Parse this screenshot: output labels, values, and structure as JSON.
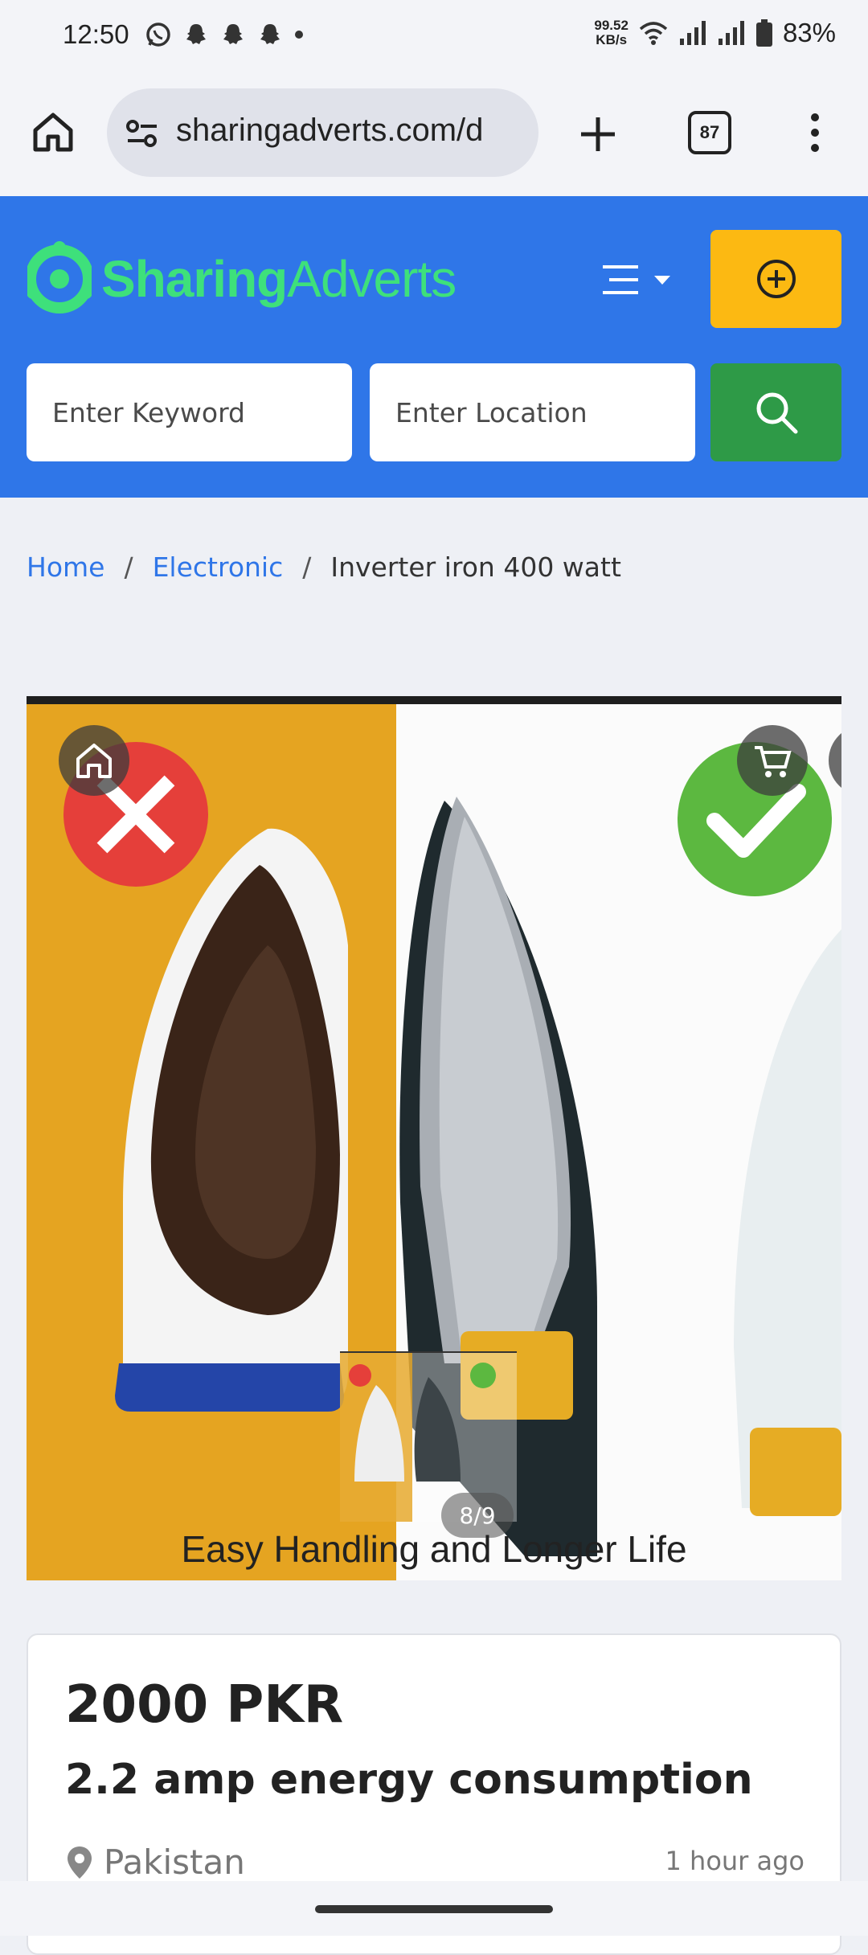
{
  "status_bar": {
    "time": "12:50",
    "net_speed_value": "99.52",
    "net_speed_unit": "KB/s",
    "battery": "83%"
  },
  "browser": {
    "url": "sharingadverts.com/d",
    "tab_count": "87"
  },
  "header": {
    "logo_part1": "Sharing",
    "logo_part2": "Adverts",
    "keyword_placeholder": "Enter Keyword",
    "location_placeholder": "Enter Location"
  },
  "breadcrumb": {
    "home": "Home",
    "category": "Electronic",
    "current": "Inverter iron 400 watt",
    "separator": "/"
  },
  "gallery": {
    "caption": "Easy Handling and Longer Life",
    "counter": "8/9"
  },
  "listing": {
    "price": "2000 PKR",
    "title": "2.2 amp energy consumption",
    "location": "Pakistan",
    "posted": "1 hour ago"
  },
  "colors": {
    "header_bg": "#2f76e8",
    "post_button": "#fcb912",
    "search_button": "#2e9a47",
    "logo_green": "#3ee07b",
    "link_blue": "#2f76e8"
  }
}
